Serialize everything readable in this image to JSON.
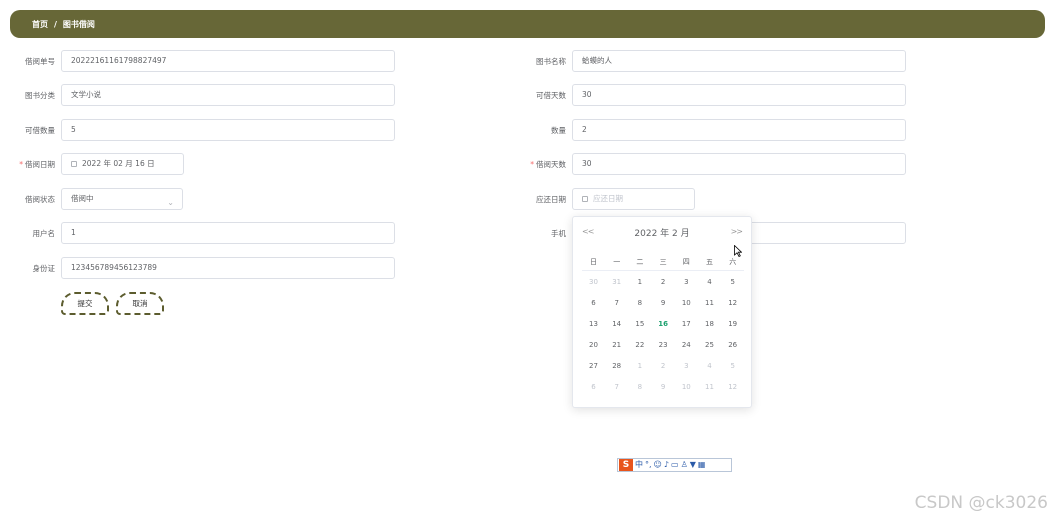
{
  "breadcrumb": {
    "home": "首页",
    "separator": "/",
    "current": "图书借阅"
  },
  "form": {
    "borrow_no": {
      "label": "借阅单号",
      "value": "20222161161798827497"
    },
    "book_name": {
      "label": "图书名称",
      "value": "蛤蟆的人"
    },
    "category": {
      "label": "图书分类",
      "value": "文学小说"
    },
    "borrowable_days": {
      "label": "可借天数",
      "value": "30"
    },
    "borrowable_qty": {
      "label": "可借数量",
      "value": "5"
    },
    "quantity": {
      "label": "数量",
      "value": "2"
    },
    "borrow_date": {
      "label": "借阅日期",
      "value": "2022 年 02 月 16 日"
    },
    "borrow_days": {
      "label": "借阅天数",
      "value": "30"
    },
    "borrow_status": {
      "label": "借阅状态",
      "value": "借阅中"
    },
    "return_date": {
      "label": "应还日期",
      "placeholder": "应还日期"
    },
    "username": {
      "label": "用户名",
      "value": "1"
    },
    "phone": {
      "label": "手机",
      "value": ""
    },
    "id_card": {
      "label": "身份证",
      "value": "123456789456123789"
    }
  },
  "buttons": {
    "submit": "提交",
    "cancel": "取消"
  },
  "date_picker": {
    "prev_year": "<<",
    "header": "2022 年  2 月",
    "next_year": ">>",
    "weekdays": [
      "日",
      "一",
      "二",
      "三",
      "四",
      "五",
      "六"
    ],
    "weeks": [
      [
        "30",
        "31",
        "1",
        "2",
        "3",
        "4",
        "5"
      ],
      [
        "6",
        "7",
        "8",
        "9",
        "10",
        "11",
        "12"
      ],
      [
        "13",
        "14",
        "15",
        "16",
        "17",
        "18",
        "19"
      ],
      [
        "20",
        "21",
        "22",
        "23",
        "24",
        "25",
        "26"
      ],
      [
        "27",
        "28",
        "1",
        "2",
        "3",
        "4",
        "5"
      ],
      [
        "6",
        "7",
        "8",
        "9",
        "10",
        "11",
        "12"
      ]
    ],
    "today": "16",
    "accent_color": "#1aa06d"
  },
  "ime_bar": {
    "logo": "S",
    "mode": "中"
  },
  "watermark": "CSDN @ck3026",
  "colors": {
    "topbar": "#676737",
    "button_border": "#5c5c2e"
  }
}
